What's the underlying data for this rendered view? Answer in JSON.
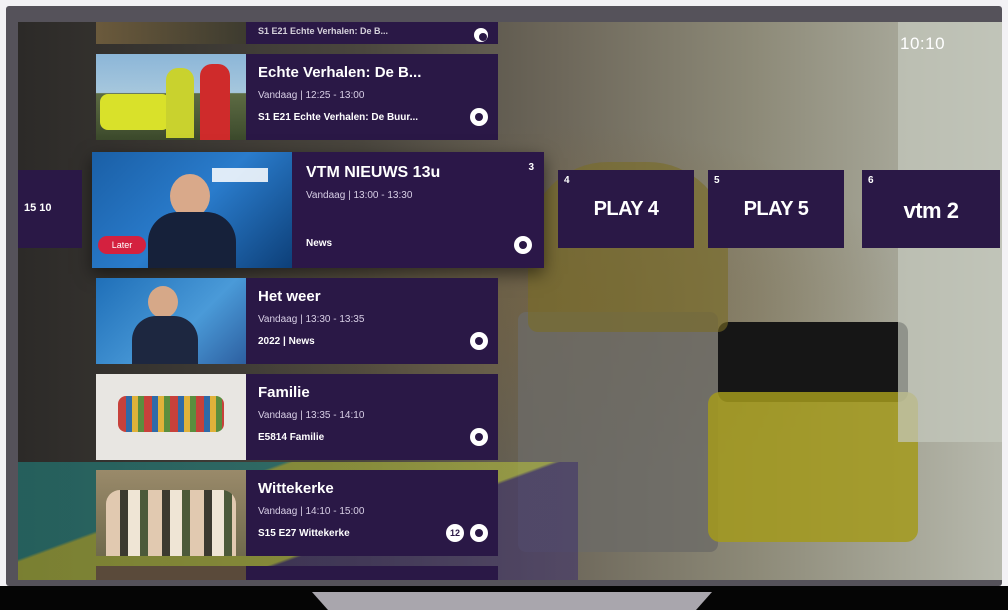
{
  "clock": "10:10",
  "colors": {
    "card_bg": "#2a1846",
    "later_badge": "#d4213f",
    "text": "#ffffff"
  },
  "programs": {
    "prev": {
      "episode": "S1 E21 Echte Verhalen: De B..."
    },
    "echte": {
      "title": "Echte Verhalen: De B...",
      "time": "Vandaag | 12:25 - 13:00",
      "episode": "S1  E21 Echte Verhalen: De Buur..."
    },
    "nieuws": {
      "title": "VTM NIEUWS 13u",
      "time": "Vandaag | 13:00 - 13:30",
      "episode": "News",
      "channel_number": "3",
      "badge": "Later"
    },
    "weer": {
      "title": "Het weer",
      "time": "Vandaag | 13:30 - 13:35",
      "episode": "2022  |  News"
    },
    "familie": {
      "title": "Familie",
      "time": "Vandaag | 13:35 - 14:10",
      "episode": "E5814 Familie"
    },
    "wittekerke": {
      "title": "Wittekerke",
      "time": "Vandaag | 14:10 - 15:00",
      "episode": "S15  E27 Wittekerke",
      "age_rating": "12"
    }
  },
  "channels": [
    {
      "number": "4",
      "logo": "PLAY 4"
    },
    {
      "number": "5",
      "logo": "PLAY 5"
    },
    {
      "number": "6",
      "logo": "vtm 2"
    }
  ],
  "channel_left": {
    "logo": "15 10"
  },
  "icons": {
    "replay": "replay-icon",
    "age": "age-rating-icon"
  }
}
